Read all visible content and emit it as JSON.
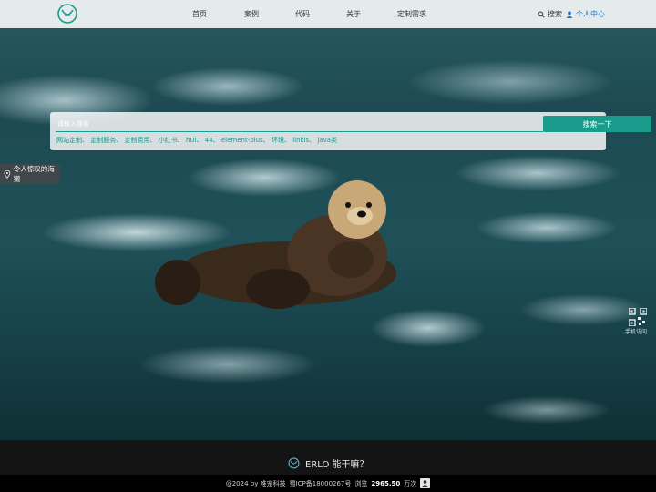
{
  "nav": {
    "items": [
      "首页",
      "案例",
      "代码",
      "关于",
      "定制需求"
    ],
    "search_label": "搜索",
    "user_label": "个人中心"
  },
  "search": {
    "placeholder": "请输入搜索",
    "button_label": "搜索一下",
    "tags": [
      "网站定制",
      "定制服务",
      "定制费用",
      "小红书",
      "hUi",
      "44",
      "element-plus",
      "环境",
      "linkis",
      "java类"
    ]
  },
  "location_tag": "令人惊叹的海獭",
  "qr_label": "手机访问",
  "footer": {
    "title": "ERLO 能干嘛？",
    "copyright": "@2024 by 唯宠科技",
    "icp": "蜀ICP备18000267号",
    "views_prefix": "浏览",
    "views_value": "2965.50",
    "views_unit": "万次"
  },
  "colors": {
    "accent": "#1a9c8c",
    "footer_bg": "#141414"
  }
}
